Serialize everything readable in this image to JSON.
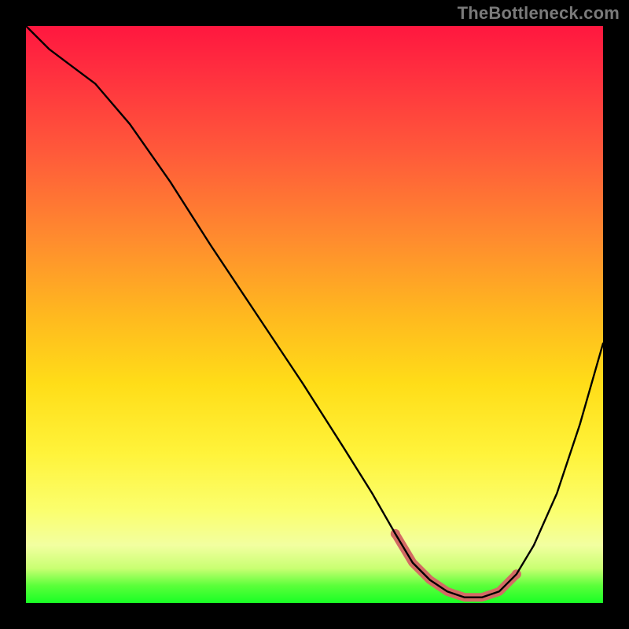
{
  "attribution": "TheBottleneck.com",
  "colors": {
    "background": "#000000",
    "gradient_top": "#ff173f",
    "gradient_mid1": "#ff8c2e",
    "gradient_mid2": "#ffdd18",
    "gradient_mid3": "#fbff6e",
    "gradient_bottom": "#18ff25",
    "curve": "#000000",
    "valley_highlight": "#d36a64",
    "attribution_text": "#7a7a7a"
  },
  "chart_data": {
    "type": "line",
    "title": "",
    "xlabel": "",
    "ylabel": "",
    "x_range": [
      0,
      100
    ],
    "y_range": [
      0,
      100
    ],
    "grid": false,
    "legend": false,
    "series": [
      {
        "name": "bottleneck_curve",
        "x": [
          0,
          4,
          8,
          12,
          18,
          25,
          32,
          40,
          48,
          55,
          60,
          64,
          67,
          70,
          73,
          76,
          79,
          82,
          85,
          88,
          92,
          96,
          100
        ],
        "y": [
          100,
          96,
          93,
          90,
          83,
          73,
          62,
          50,
          38,
          27,
          19,
          12,
          7,
          4,
          2,
          1,
          1,
          2,
          5,
          10,
          19,
          31,
          45
        ]
      }
    ],
    "highlight_segment": {
      "name": "valley_highlight",
      "x": [
        64,
        67,
        70,
        73,
        76,
        79,
        82,
        85
      ],
      "y": [
        12,
        7,
        4,
        2,
        1,
        1,
        2,
        5
      ]
    }
  }
}
